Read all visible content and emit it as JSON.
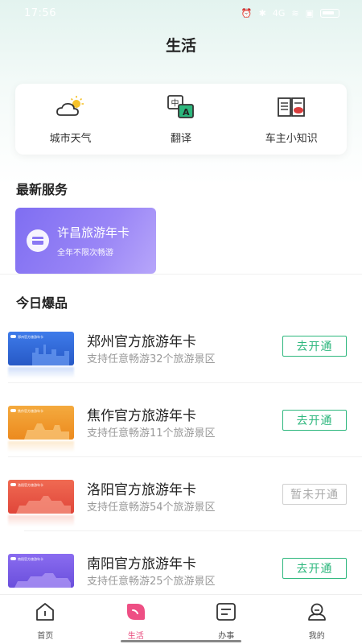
{
  "status_bar": {
    "time": "17:56",
    "network": "4G"
  },
  "page": {
    "title": "生活"
  },
  "tools": [
    {
      "label": "城市天气",
      "icon": "weather-icon"
    },
    {
      "label": "翻译",
      "icon": "translate-icon"
    },
    {
      "label": "车主小知识",
      "icon": "book-icon"
    }
  ],
  "latest_services": {
    "title": "最新服务",
    "card": {
      "title": "许昌旅游年卡",
      "subtitle": "全年不限次畅游"
    }
  },
  "today_hot": {
    "title": "今日爆品",
    "items": [
      {
        "title": "郑州官方旅游年卡",
        "subtitle": "支持任意畅游32个旅游景区",
        "button": "去开通",
        "button_state": "active",
        "thumb_label": "郑州官方旅游年卡",
        "color": "#2f6bd9"
      },
      {
        "title": "焦作官方旅游年卡",
        "subtitle": "支持任意畅游11个旅游景区",
        "button": "去开通",
        "button_state": "active",
        "thumb_label": "焦作官方旅游年卡",
        "color": "#f09a2a"
      },
      {
        "title": "洛阳官方旅游年卡",
        "subtitle": "支持任意畅游54个旅游景区",
        "button": "暂未开通",
        "button_state": "inactive",
        "thumb_label": "洛阳官方旅游年卡",
        "color": "#ec5a48"
      },
      {
        "title": "南阳官方旅游年卡",
        "subtitle": "支持任意畅游25个旅游景区",
        "button": "去开通",
        "button_state": "active",
        "thumb_label": "南阳官方旅游年卡",
        "color": "#7c5ee8"
      }
    ]
  },
  "tab_bar": [
    {
      "label": "首页",
      "icon": "home-icon",
      "active": false
    },
    {
      "label": "生活",
      "icon": "life-icon",
      "active": true
    },
    {
      "label": "办事",
      "icon": "tasks-icon",
      "active": false
    },
    {
      "label": "我的",
      "icon": "profile-icon",
      "active": false
    }
  ],
  "colors": {
    "accent_green": "#2db77d",
    "accent_pink": "#e8467a",
    "service_purple": "#8a78f4"
  }
}
